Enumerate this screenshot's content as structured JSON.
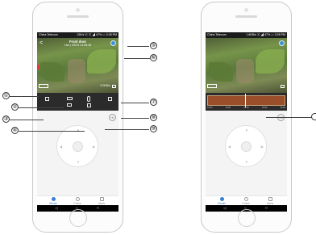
{
  "left_phone": {
    "status_bar": {
      "carrier": "China Telecom",
      "right": "13K/s ⓔ ⊙ ◢ 47% ▭ 3:28 PM"
    },
    "video": {
      "back": "<",
      "title": "Front door",
      "timestamp": "Live | 05/23 14:08:46",
      "speed": "0.0KB/s"
    }
  },
  "right_phone": {
    "status_bar": {
      "carrier": "China Telecom",
      "right": "1.6KB/s ⓔ ◢ 47% ▭ 3:28 PM"
    },
    "timeline": {
      "ticks": [
        "12:00",
        "13:00",
        "14:00",
        "15:00",
        "16:00"
      ]
    }
  },
  "dpad": {
    "up": "▲",
    "down": "▼",
    "left": "◀",
    "right": "▶",
    "hd_label": "HD"
  },
  "tabs": [
    "Stream",
    "Cruise",
    "Alerts"
  ],
  "navbar": {
    "back": "◁",
    "home": "○",
    "recent": "□"
  },
  "callouts": [
    "①",
    "②",
    "③",
    "④",
    "⑤",
    "⑥",
    "⑦",
    "⑧",
    "⑨"
  ],
  "colors": {
    "accent": "#3a7fd6",
    "timeline_fill": "#9a4f2a",
    "video_bar": "#2b2b2b"
  }
}
